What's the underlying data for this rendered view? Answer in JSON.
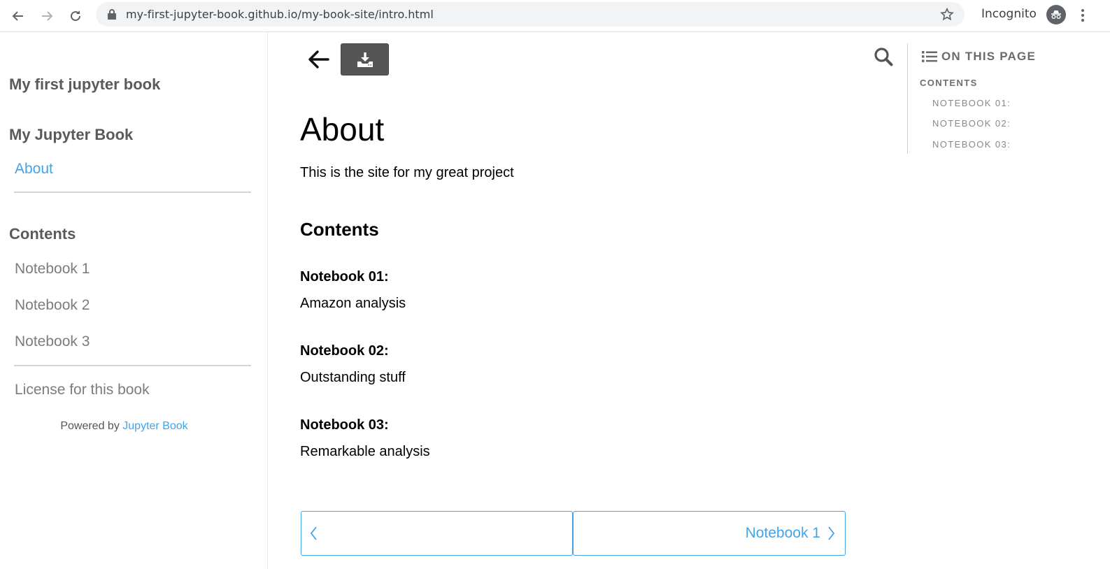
{
  "browser": {
    "url": "my-first-jupyter-book.github.io/my-book-site/intro.html",
    "incognito_label": "Incognito",
    "icons": [
      "back-arrow-icon",
      "forward-arrow-icon",
      "reload-icon",
      "lock-icon",
      "star-icon",
      "incognito-icon",
      "more-vert-icon"
    ]
  },
  "sidebar": {
    "title": "My first jupyter book",
    "sections": [
      {
        "heading": "My Jupyter Book",
        "items": [
          {
            "label": "About",
            "active": true
          }
        ]
      },
      {
        "heading": "Contents",
        "items": [
          {
            "label": "Notebook 1"
          },
          {
            "label": "Notebook 2"
          },
          {
            "label": "Notebook 3"
          }
        ]
      }
    ],
    "license_link": "License for this book",
    "powered_prefix": "Powered by",
    "powered_link": "Jupyter Book"
  },
  "toolbar": {
    "icons": [
      "arrow-left-icon",
      "download-icon",
      "search-icon"
    ]
  },
  "main": {
    "title": "About",
    "intro": "This is the site for my great project",
    "contents_heading": "Contents",
    "notebooks": [
      {
        "heading": "Notebook 01:",
        "description": "Amazon analysis"
      },
      {
        "heading": "Notebook 02:",
        "description": "Outstanding stuff"
      },
      {
        "heading": "Notebook 03:",
        "description": "Remarkable analysis"
      }
    ]
  },
  "pager": {
    "prev_label": "",
    "next_label": "Notebook 1"
  },
  "toc": {
    "heading": "ON THIS PAGE",
    "items": [
      {
        "label": "CONTENTS",
        "level": 1
      },
      {
        "label": "NOTEBOOK 01:",
        "level": 2
      },
      {
        "label": "NOTEBOOK 02:",
        "level": 2
      },
      {
        "label": "NOTEBOOK 03:",
        "level": 2
      }
    ]
  },
  "colors": {
    "link": "#42a4e6",
    "sidebar_text": "#7c7c7c",
    "download_bg": "#555555"
  }
}
